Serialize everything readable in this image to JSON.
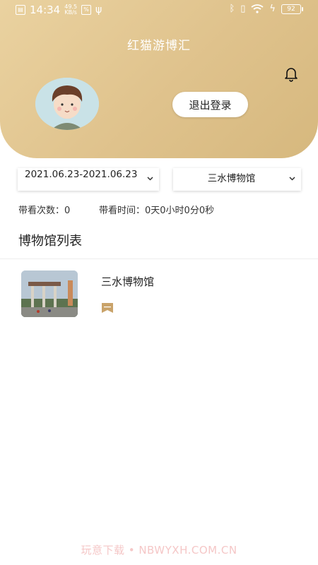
{
  "status_bar": {
    "time": "14:34",
    "net_speed_value": "49.5",
    "net_speed_unit": "KB/s",
    "hd_badge": "%",
    "battery": "92"
  },
  "header": {
    "title": "红猫游博汇",
    "logout_label": "退出登录"
  },
  "filters": {
    "date_range": "2021.06.23-2021.06.23",
    "museum": "三水博物馆"
  },
  "stats": {
    "count_label": "带看次数：",
    "count_value": "0",
    "time_label": "带看时间：",
    "time_value": "0天0小时0分0秒"
  },
  "section": {
    "title": "博物馆列表"
  },
  "museums": [
    {
      "name": "三水博物馆",
      "badge_icon": "bookmark-icon"
    }
  ],
  "watermark": "玩意下载 • NBWYXH.COM.CN",
  "colors": {
    "header_gold": "#dfc28c",
    "badge_gold": "#c9a36a",
    "watermark": "#f5c7c7"
  }
}
